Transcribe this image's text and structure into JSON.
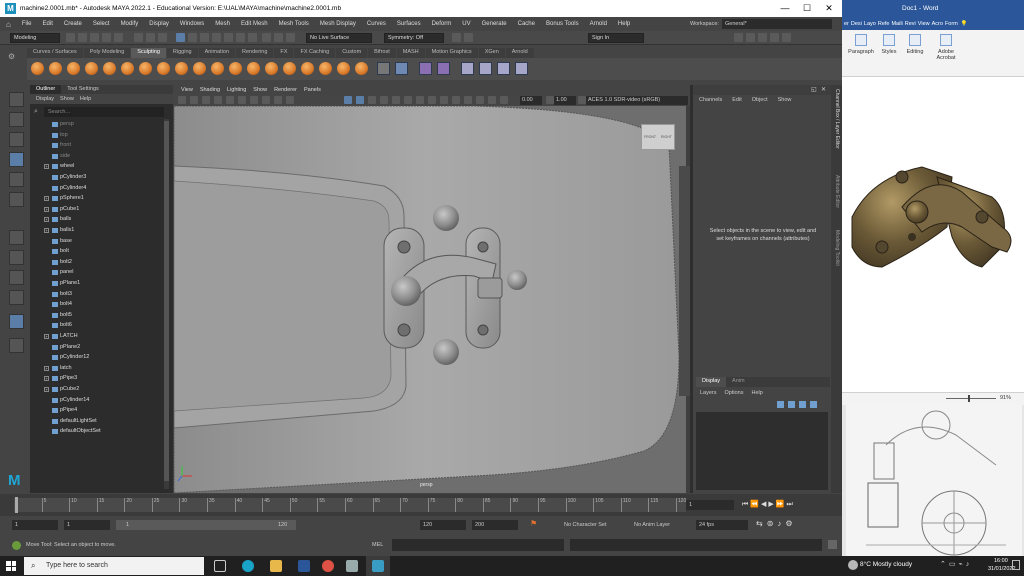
{
  "maya": {
    "title": "machine2.0001.mb* - Autodesk MAYA 2022.1 - Educational Version: E:\\UAL\\MAYA\\machine\\machine2.0001.mb",
    "window_controls": [
      "—",
      "☐",
      "✕"
    ],
    "menu": [
      "File",
      "Edit",
      "Create",
      "Select",
      "Modify",
      "Display",
      "Windows",
      "Mesh",
      "Edit Mesh",
      "Mesh Tools",
      "Mesh Display",
      "Curves",
      "Surfaces",
      "Deform",
      "UV",
      "Generate",
      "Cache",
      "Bonus Tools",
      "Arnold",
      "Help"
    ],
    "workspace_label": "Workspace:",
    "workspace_value": "General*",
    "mode": "Modeling",
    "live_surface": "No Live Surface",
    "symmetry": "Symmetry: Off",
    "sign_in": "Sign In",
    "shelf_tabs": [
      "Curves / Surfaces",
      "Poly Modeling",
      "Sculpting",
      "Rigging",
      "Animation",
      "Rendering",
      "FX",
      "FX Caching",
      "Custom",
      "Bifrost",
      "MASH",
      "Motion Graphics",
      "XGen",
      "Arnold"
    ],
    "active_shelf": "Sculpting",
    "outliner": {
      "tabs": [
        "Outliner",
        "Tool Settings"
      ],
      "menu": [
        "Display",
        "Show",
        "Help"
      ],
      "search_placeholder": "Search...",
      "items": [
        {
          "label": "persp",
          "dim": true
        },
        {
          "label": "top",
          "dim": true
        },
        {
          "label": "front",
          "dim": true
        },
        {
          "label": "side",
          "dim": true
        },
        {
          "label": "wheel",
          "expand": true
        },
        {
          "label": "pCylinder3"
        },
        {
          "label": "pCylinder4"
        },
        {
          "label": "pSphere1",
          "expand": true
        },
        {
          "label": "pCube1",
          "expand": true
        },
        {
          "label": "balls",
          "expand": true
        },
        {
          "label": "balls1",
          "expand": true
        },
        {
          "label": "base"
        },
        {
          "label": "bolt"
        },
        {
          "label": "bolt2"
        },
        {
          "label": "panel"
        },
        {
          "label": "pPlane1"
        },
        {
          "label": "bolt3"
        },
        {
          "label": "bolt4"
        },
        {
          "label": "bolt5"
        },
        {
          "label": "bolt6"
        },
        {
          "label": "LATCH",
          "expand": true
        },
        {
          "label": "pPlane2"
        },
        {
          "label": "pCylinder12"
        },
        {
          "label": "latch",
          "expand": true
        },
        {
          "label": "pPipe3",
          "expand": true
        },
        {
          "label": "pCube2",
          "expand": true
        },
        {
          "label": "pCylinder14"
        },
        {
          "label": "pPipe4"
        },
        {
          "label": "defaultLightSet"
        },
        {
          "label": "defaultObjectSet"
        }
      ]
    },
    "viewport": {
      "menu": [
        "View",
        "Shading",
        "Lighting",
        "Show",
        "Renderer",
        "Panels"
      ],
      "value1": "0.00",
      "value2": "1.00",
      "colorspace": "ACES 1.0 SDR-video (sRGB)",
      "camera_label": "persp",
      "viewcube": [
        "FRONT",
        "RIGHT"
      ]
    },
    "channel_box": {
      "menu": [
        "Channels",
        "Edit",
        "Object",
        "Show"
      ],
      "message": "Select objects in the scene to view, edit and set keyframes on channels (attributes)"
    },
    "side_tabs": [
      "Channel Box / Layer Editor",
      "Attribute Editor",
      "Modeling Toolkit"
    ],
    "layer_editor": {
      "tabs": [
        "Display",
        "Anim"
      ],
      "menu": [
        "Layers",
        "Options",
        "Help"
      ]
    },
    "timeline": {
      "ticks": [
        "5",
        "10",
        "15",
        "20",
        "25",
        "30",
        "35",
        "40",
        "45",
        "50",
        "55",
        "60",
        "65",
        "70",
        "75",
        "80",
        "85",
        "90",
        "95",
        "100",
        "105",
        "110",
        "115",
        "120"
      ],
      "current_frame": "1"
    },
    "range": {
      "start": "1",
      "anim_start": "1",
      "slider_start": "1",
      "slider_end": "120",
      "anim_end": "120",
      "end": "200",
      "character_set": "No Character Set",
      "anim_layer": "No Anim Layer",
      "fps": "24 fps"
    },
    "cmd": {
      "lang": "MEL"
    },
    "status": "Move Tool: Select an object to move."
  },
  "word": {
    "title": "Doc1 - Word",
    "tabs": [
      "er",
      "Desi",
      "Layo",
      "Refe",
      "Maili",
      "Revi",
      "View",
      "Acro",
      "Form"
    ],
    "ribbon": [
      {
        "label": "Paragraph"
      },
      {
        "label": "Styles"
      },
      {
        "label": "Editing"
      },
      {
        "label": "Adobe Acrobat"
      }
    ],
    "zoom": "91%"
  },
  "taskbar": {
    "search_placeholder": "Type here to search",
    "weather": "8°C  Mostly cloudy",
    "time": "16:00",
    "date": "31/01/2022"
  }
}
